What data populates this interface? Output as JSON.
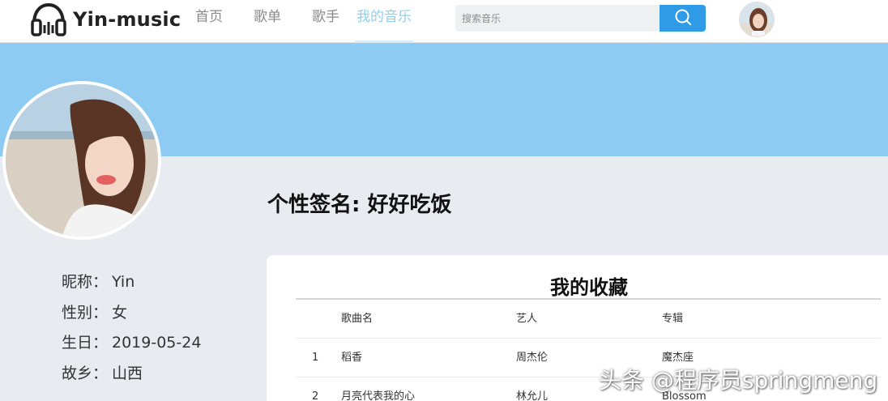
{
  "app": {
    "logo_text": "Yin-music",
    "logo_icon": "headphones-icon"
  },
  "nav": {
    "items": [
      {
        "label": "首页",
        "active": false
      },
      {
        "label": "歌单",
        "active": false
      },
      {
        "label": "歌手",
        "active": false
      },
      {
        "label": "我的音乐",
        "active": true
      }
    ]
  },
  "search": {
    "placeholder": "搜索音乐",
    "button_icon": "search-icon"
  },
  "profile": {
    "signature_label": "个性签名:",
    "signature_value": "好好吃饭",
    "info": [
      {
        "key": "昵称：",
        "value": "Yin"
      },
      {
        "key": "性别：",
        "value": "女"
      },
      {
        "key": "生日：",
        "value": "2019-05-24"
      },
      {
        "key": "故乡：",
        "value": "山西"
      }
    ]
  },
  "favorites": {
    "title": "我的收藏",
    "columns": [
      "歌曲名",
      "艺人",
      "专辑"
    ],
    "rows": [
      {
        "index": "1",
        "name": "稻香",
        "artist": "周杰伦",
        "album": "魔杰座"
      },
      {
        "index": "2",
        "name": "月亮代表我的心",
        "artist": "林允儿",
        "album": "Blossom"
      }
    ]
  },
  "watermark": "头条 @程序员springmeng",
  "colors": {
    "banner": "#8ecbf3",
    "accent": "#2f9ae6",
    "nav_active": "#8ed0f2",
    "page_bg": "#e8ecf0"
  }
}
